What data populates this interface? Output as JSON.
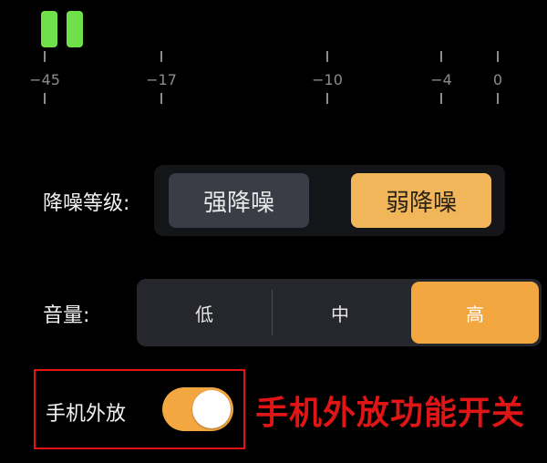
{
  "meter": {
    "level_color": "#6fe04a",
    "ticks": [
      "−45",
      "−17",
      "−10",
      "−4",
      "0"
    ]
  },
  "noise_reduction": {
    "label": "降噪等级:",
    "options": [
      "强降噪",
      "弱降噪"
    ],
    "selected": "弱降噪"
  },
  "volume": {
    "label": "音量:",
    "options": [
      "低",
      "中",
      "高"
    ],
    "selected": "高"
  },
  "speaker": {
    "label": "手机外放",
    "enabled": true
  },
  "annotation": {
    "text": "手机外放功能开关",
    "color": "#e01515"
  },
  "colors": {
    "accent": "#f2a741",
    "selected_nr": "#f2b65a"
  }
}
